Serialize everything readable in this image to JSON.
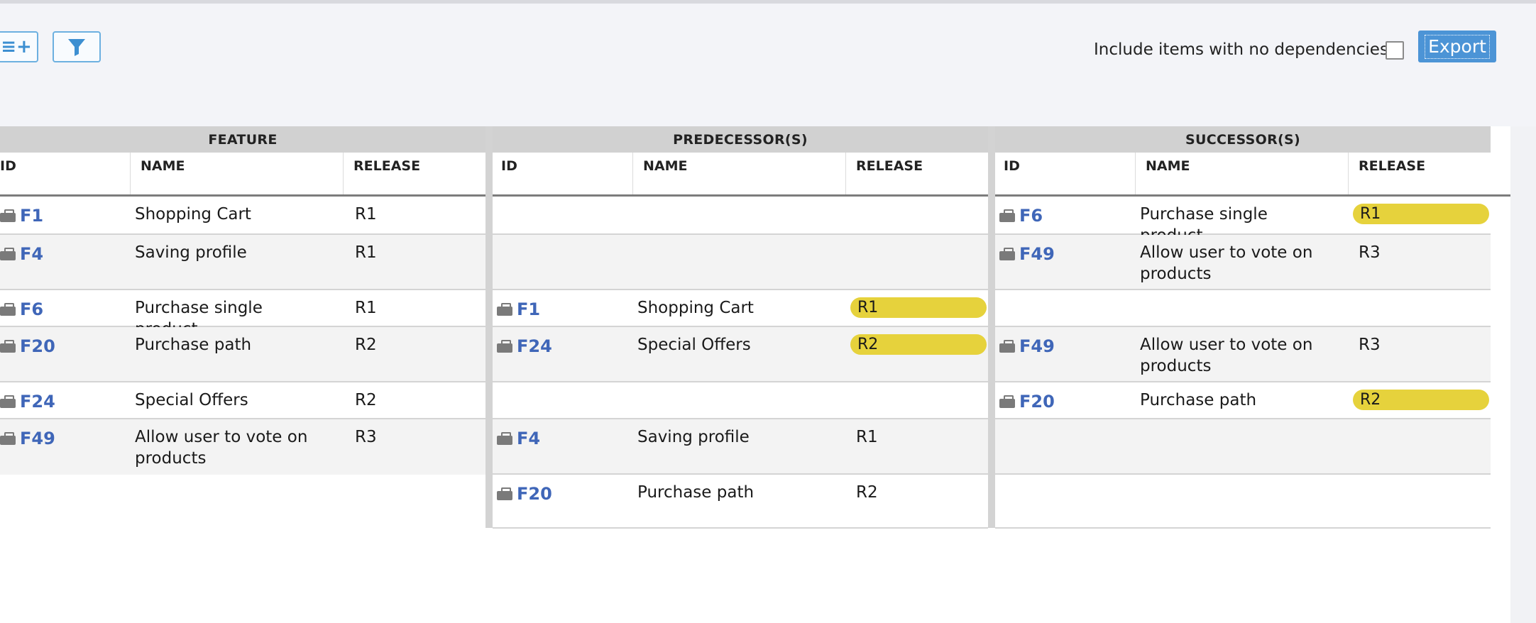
{
  "toolbar": {
    "add_icon": "list-add-icon",
    "filter_icon": "funnel-icon",
    "include_label": "Include items with no dependencies:",
    "include_checked": false,
    "export_label": "Export"
  },
  "groups": {
    "feature": "FEATURE",
    "predecessor": "PREDECESSOR(S)",
    "successor": "SUCCESSOR(S)"
  },
  "columns": {
    "id": "ID",
    "name": "NAME",
    "release": "RELEASE"
  },
  "colors": {
    "highlight": "#e6d23c",
    "link": "#3f66b8",
    "accent": "#4c94d6"
  },
  "rows": [
    {
      "feature": {
        "id": "F1",
        "name": "Shopping Cart",
        "release": "R1"
      },
      "predecessor": null,
      "successor": {
        "id": "F6",
        "name": "Purchase single product",
        "release": "R1",
        "highlight": true
      }
    },
    {
      "feature": {
        "id": "F4",
        "name": "Saving profile",
        "release": "R1"
      },
      "predecessor": null,
      "successor": {
        "id": "F49",
        "name": "Allow user to vote on products",
        "release": "R3",
        "highlight": false
      }
    },
    {
      "feature": {
        "id": "F6",
        "name": "Purchase single product",
        "release": "R1"
      },
      "predecessor": {
        "id": "F1",
        "name": "Shopping Cart",
        "release": "R1",
        "highlight": true
      },
      "successor": null
    },
    {
      "feature": {
        "id": "F20",
        "name": "Purchase path",
        "release": "R2"
      },
      "predecessor": {
        "id": "F24",
        "name": "Special Offers",
        "release": "R2",
        "highlight": true
      },
      "successor": {
        "id": "F49",
        "name": "Allow user to vote on products",
        "release": "R3",
        "highlight": false
      }
    },
    {
      "feature": {
        "id": "F24",
        "name": "Special Offers",
        "release": "R2"
      },
      "predecessor": null,
      "successor": {
        "id": "F20",
        "name": "Purchase path",
        "release": "R2",
        "highlight": true
      }
    },
    {
      "feature": {
        "id": "F49",
        "name": "Allow user to vote on products",
        "release": "R3"
      },
      "predecessor": {
        "id": "F4",
        "name": "Saving profile",
        "release": "R1",
        "highlight": false
      },
      "successor": null
    },
    {
      "feature": null,
      "predecessor": {
        "id": "F20",
        "name": "Purchase path",
        "release": "R2",
        "highlight": false
      },
      "successor": null
    }
  ]
}
